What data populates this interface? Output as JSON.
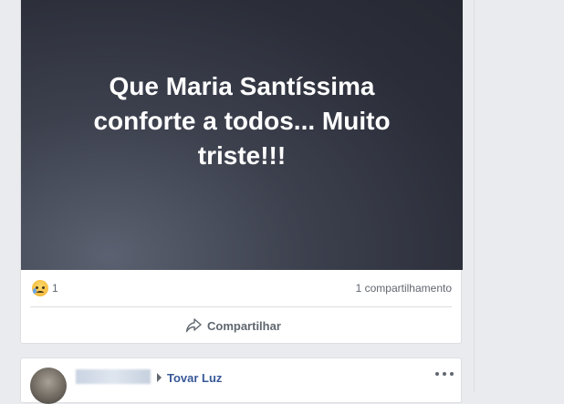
{
  "post": {
    "text": "Que Maria Santíssima conforte a todos... Muito triste!!!",
    "reaction_icon": "sad-reaction-icon",
    "reaction_count": "1",
    "shares": "1 compartilhamento",
    "share_label": "Compartilhar",
    "share_icon": "share-arrow-icon"
  },
  "next_post": {
    "page_name": "Tovar Luz",
    "more_icon": "ellipsis-icon"
  },
  "colors": {
    "link": "#385898",
    "background": "#e9ebee",
    "card": "#ffffff",
    "text_secondary": "#606770"
  }
}
